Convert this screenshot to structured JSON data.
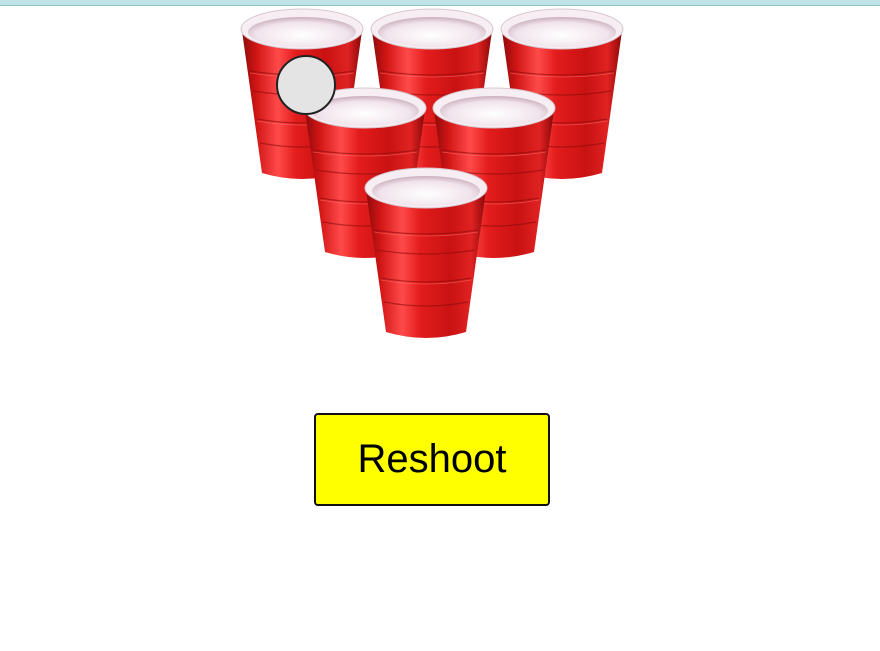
{
  "game": {
    "cups_remaining": 6,
    "cup_color": "#d21616",
    "cup_rim_color": "#f7f0f4",
    "ball_color": "#e4e4e4",
    "formation": [
      "back-left",
      "back-center",
      "back-right",
      "middle-left",
      "middle-right",
      "front-center"
    ]
  },
  "controls": {
    "reshoot_label": "Reshoot",
    "reshoot_color": "#ffff00"
  },
  "theme": {
    "top_bar_color": "#bfe3e6",
    "background": "#ffffff"
  }
}
